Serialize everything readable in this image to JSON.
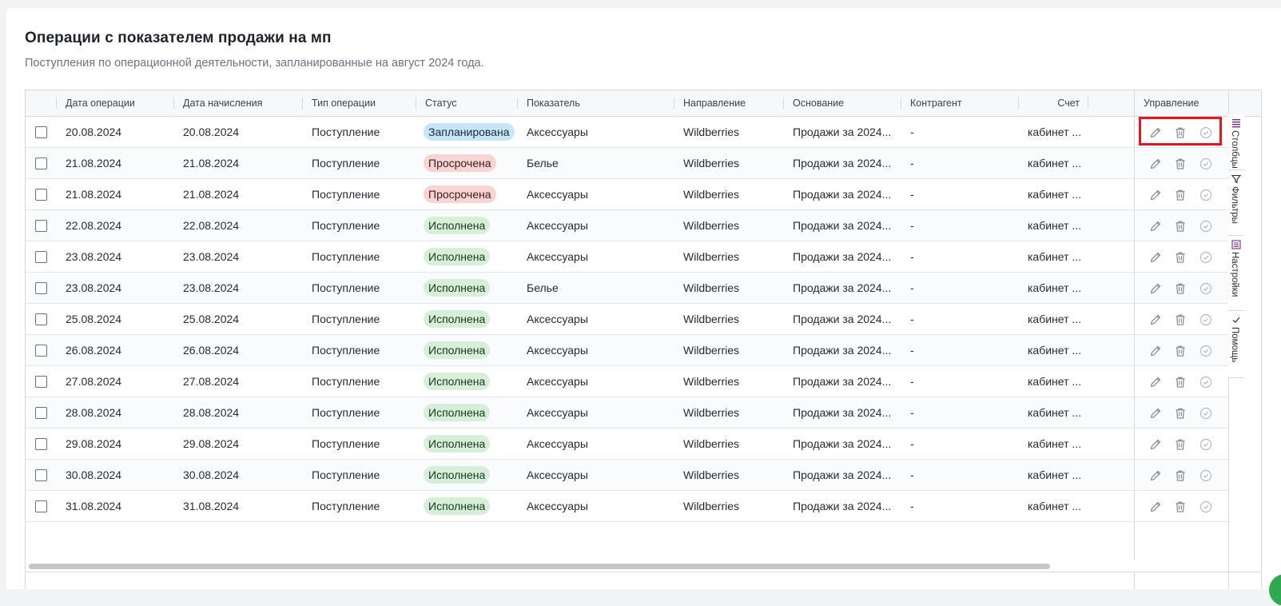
{
  "header": {
    "title": "Операции с показателем продажи на мп",
    "subtitle": "Поступления по операционной деятельности, запланированные на август 2024 года."
  },
  "columns": {
    "date_op": "Дата операции",
    "date_acc": "Дата начисления",
    "op_type": "Тип операции",
    "status": "Статус",
    "indicator": "Показатель",
    "direction": "Направление",
    "basis": "Основание",
    "counterparty": "Контрагент",
    "account": "Счет",
    "management": "Управление"
  },
  "rows": [
    {
      "date_op": "20.08.2024",
      "date_acc": "20.08.2024",
      "op_type": "Поступление",
      "status": "Запланирована",
      "status_kind": "planned",
      "indicator": "Аксессуары",
      "direction": "Wildberries",
      "basis": "Продажи за 2024...",
      "counterparty": "-",
      "account": "кабинет ..."
    },
    {
      "date_op": "21.08.2024",
      "date_acc": "21.08.2024",
      "op_type": "Поступление",
      "status": "Просрочена",
      "status_kind": "overdue",
      "indicator": "Белье",
      "direction": "Wildberries",
      "basis": "Продажи за 2024...",
      "counterparty": "-",
      "account": "кабинет ..."
    },
    {
      "date_op": "21.08.2024",
      "date_acc": "21.08.2024",
      "op_type": "Поступление",
      "status": "Просрочена",
      "status_kind": "overdue",
      "indicator": "Аксессуары",
      "direction": "Wildberries",
      "basis": "Продажи за 2024...",
      "counterparty": "-",
      "account": "кабинет ..."
    },
    {
      "date_op": "22.08.2024",
      "date_acc": "22.08.2024",
      "op_type": "Поступление",
      "status": "Исполнена",
      "status_kind": "done",
      "indicator": "Аксессуары",
      "direction": "Wildberries",
      "basis": "Продажи за 2024...",
      "counterparty": "-",
      "account": "кабинет ..."
    },
    {
      "date_op": "23.08.2024",
      "date_acc": "23.08.2024",
      "op_type": "Поступление",
      "status": "Исполнена",
      "status_kind": "done",
      "indicator": "Аксессуары",
      "direction": "Wildberries",
      "basis": "Продажи за 2024...",
      "counterparty": "-",
      "account": "кабинет ..."
    },
    {
      "date_op": "23.08.2024",
      "date_acc": "23.08.2024",
      "op_type": "Поступление",
      "status": "Исполнена",
      "status_kind": "done",
      "indicator": "Белье",
      "direction": "Wildberries",
      "basis": "Продажи за 2024...",
      "counterparty": "-",
      "account": "кабинет ..."
    },
    {
      "date_op": "25.08.2024",
      "date_acc": "25.08.2024",
      "op_type": "Поступление",
      "status": "Исполнена",
      "status_kind": "done",
      "indicator": "Аксессуары",
      "direction": "Wildberries",
      "basis": "Продажи за 2024...",
      "counterparty": "-",
      "account": "кабинет ..."
    },
    {
      "date_op": "26.08.2024",
      "date_acc": "26.08.2024",
      "op_type": "Поступление",
      "status": "Исполнена",
      "status_kind": "done",
      "indicator": "Аксессуары",
      "direction": "Wildberries",
      "basis": "Продажи за 2024...",
      "counterparty": "-",
      "account": "кабинет ..."
    },
    {
      "date_op": "27.08.2024",
      "date_acc": "27.08.2024",
      "op_type": "Поступление",
      "status": "Исполнена",
      "status_kind": "done",
      "indicator": "Аксессуары",
      "direction": "Wildberries",
      "basis": "Продажи за 2024...",
      "counterparty": "-",
      "account": "кабинет ..."
    },
    {
      "date_op": "28.08.2024",
      "date_acc": "28.08.2024",
      "op_type": "Поступление",
      "status": "Исполнена",
      "status_kind": "done",
      "indicator": "Аксессуары",
      "direction": "Wildberries",
      "basis": "Продажи за 2024...",
      "counterparty": "-",
      "account": "кабинет ..."
    },
    {
      "date_op": "29.08.2024",
      "date_acc": "29.08.2024",
      "op_type": "Поступление",
      "status": "Исполнена",
      "status_kind": "done",
      "indicator": "Аксессуары",
      "direction": "Wildberries",
      "basis": "Продажи за 2024...",
      "counterparty": "-",
      "account": "кабинет ..."
    },
    {
      "date_op": "30.08.2024",
      "date_acc": "30.08.2024",
      "op_type": "Поступление",
      "status": "Исполнена",
      "status_kind": "done",
      "indicator": "Аксессуары",
      "direction": "Wildberries",
      "basis": "Продажи за 2024...",
      "counterparty": "-",
      "account": "кабинет ..."
    },
    {
      "date_op": "31.08.2024",
      "date_acc": "31.08.2024",
      "op_type": "Поступление",
      "status": "Исполнена",
      "status_kind": "done",
      "indicator": "Аксессуары",
      "direction": "Wildberries",
      "basis": "Продажи за 2024...",
      "counterparty": "-",
      "account": "кабинет ..."
    }
  ],
  "row_actions": {
    "edit_icon": "pencil-icon",
    "delete_icon": "trash-icon",
    "complete_icon": "check-circle-icon"
  },
  "side_panel": {
    "tabs": [
      {
        "label": "Столбцы",
        "icon": "columns-icon"
      },
      {
        "label": "Фильтры",
        "icon": "filter-icon"
      },
      {
        "label": "Настройки",
        "icon": "settings-icon"
      },
      {
        "label": "Помощь",
        "icon": "check-icon"
      }
    ]
  },
  "colors": {
    "planned_bg": "#c6e6f8",
    "overdue_bg": "#fad3d3",
    "done_bg": "#d6efd9",
    "highlight": "#e8141e"
  }
}
